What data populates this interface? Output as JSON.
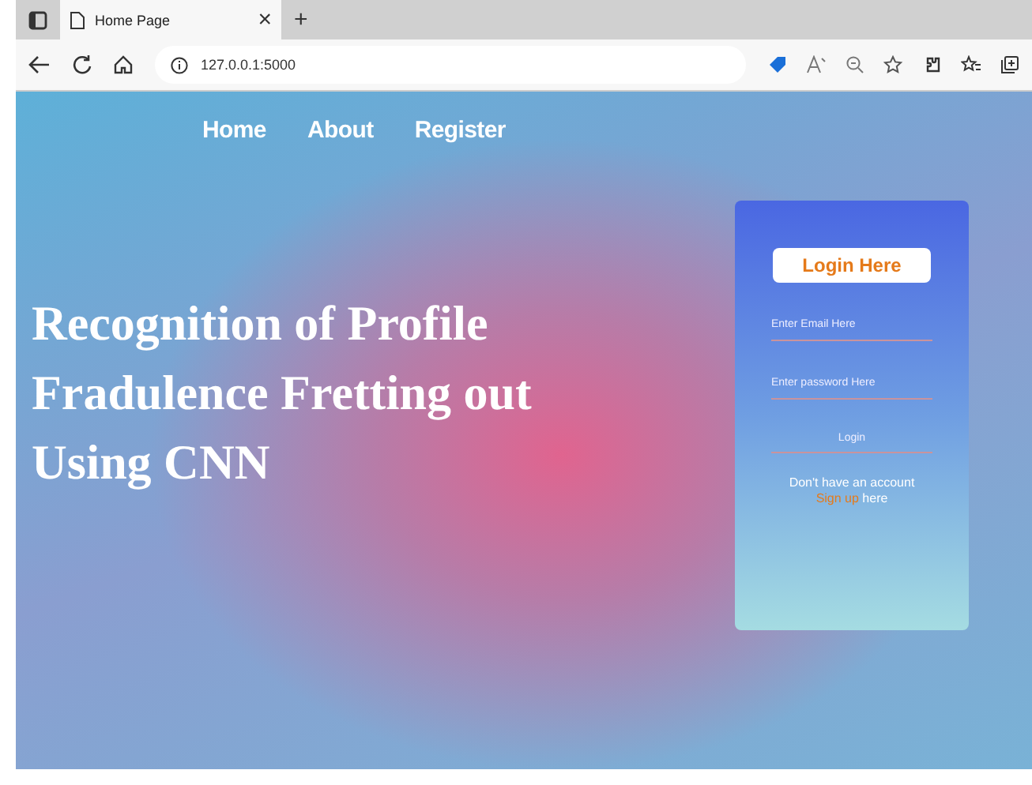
{
  "browser": {
    "tab": {
      "title": "Home Page",
      "close": "×",
      "selected": true
    },
    "new_tab": "+",
    "address": "127.0.0.1:5000"
  },
  "nav": {
    "items": [
      {
        "label": "Home"
      },
      {
        "label": "About"
      },
      {
        "label": "Register"
      }
    ]
  },
  "hero": {
    "title_lines": [
      "Recognition of Profile",
      "Fradulence Fretting out",
      "Using CNN"
    ]
  },
  "login_card": {
    "heading": "Login Here",
    "email_placeholder": "Enter Email Here",
    "password_placeholder": "Enter password Here",
    "submit": "Login",
    "prompt": "Don't have an account",
    "signup_link": "Sign up",
    "signup_suffix": "here"
  }
}
